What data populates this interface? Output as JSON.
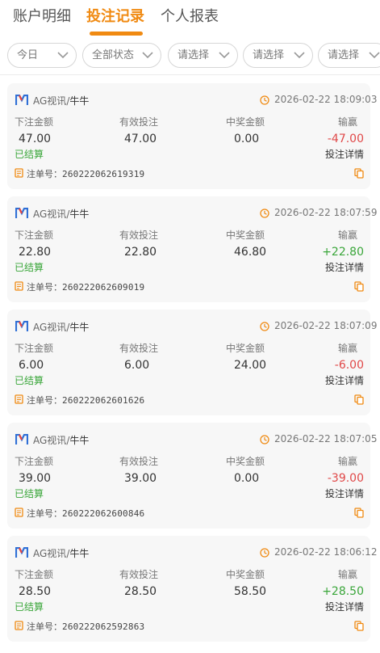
{
  "tabs": [
    {
      "label": "账户明细",
      "active": false
    },
    {
      "label": "投注记录",
      "active": true
    },
    {
      "label": "个人报表",
      "active": false
    }
  ],
  "filters": [
    {
      "label": "今日"
    },
    {
      "label": "全部状态"
    },
    {
      "label": "请选择"
    },
    {
      "label": "请选择"
    },
    {
      "label": "请选择"
    }
  ],
  "colors": {
    "accent": "#f08a12",
    "loss": "#e04848",
    "win": "#3aa63a"
  },
  "records": [
    {
      "game": "AG视讯",
      "sub": "牛牛",
      "time": "2026-02-22 18:09:03",
      "headers": [
        "下注金额",
        "有效投注",
        "中奖金额",
        "输赢"
      ],
      "bet": "47.00",
      "valid": "47.00",
      "win": "0.00",
      "result": "-47.00",
      "status": "已结算",
      "detail_link": "投注详情",
      "order_label": "注单号：",
      "order_no": "260222062619319"
    },
    {
      "game": "AG视讯",
      "sub": "牛牛",
      "time": "2026-02-22 18:07:59",
      "headers": [
        "下注金额",
        "有效投注",
        "中奖金额",
        "输赢"
      ],
      "bet": "22.80",
      "valid": "22.80",
      "win": "46.80",
      "result": "+22.80",
      "status": "已结算",
      "detail_link": "投注详情",
      "order_label": "注单号：",
      "order_no": "260222062609019"
    },
    {
      "game": "AG视讯",
      "sub": "牛牛",
      "time": "2026-02-22 18:07:09",
      "headers": [
        "下注金额",
        "有效投注",
        "中奖金额",
        "输赢"
      ],
      "bet": "6.00",
      "valid": "6.00",
      "win": "24.00",
      "result": "-6.00",
      "status": "已结算",
      "detail_link": "投注详情",
      "order_label": "注单号：",
      "order_no": "260222062601626"
    },
    {
      "game": "AG视讯",
      "sub": "牛牛",
      "time": "2026-02-22 18:07:05",
      "headers": [
        "下注金额",
        "有效投注",
        "中奖金额",
        "输赢"
      ],
      "bet": "39.00",
      "valid": "39.00",
      "win": "0.00",
      "result": "-39.00",
      "status": "已结算",
      "detail_link": "投注详情",
      "order_label": "注单号：",
      "order_no": "260222062600846"
    },
    {
      "game": "AG视讯",
      "sub": "牛牛",
      "time": "2026-02-22 18:06:12",
      "headers": [
        "下注金额",
        "有效投注",
        "中奖金额",
        "输赢"
      ],
      "bet": "28.50",
      "valid": "28.50",
      "win": "58.50",
      "result": "+28.50",
      "status": "已结算",
      "detail_link": "投注详情",
      "order_label": "注单号：",
      "order_no": "260222062592863"
    }
  ]
}
